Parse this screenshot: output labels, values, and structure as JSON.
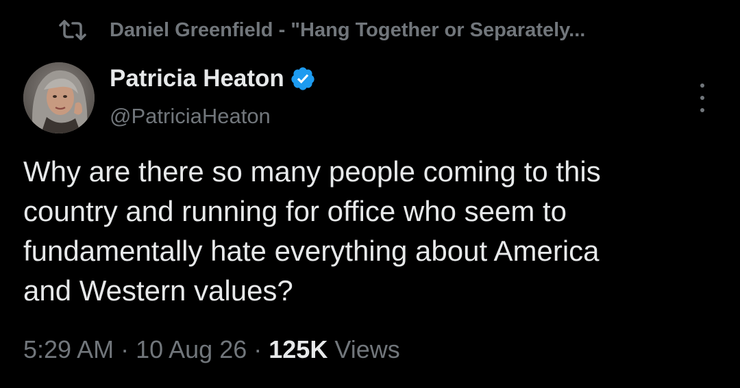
{
  "retweet": {
    "icon": "retweet-icon",
    "text": "Daniel Greenfield - \"Hang Together or Separately..."
  },
  "author": {
    "name": "Patricia Heaton",
    "handle": "@PatriciaHeaton",
    "verified_icon": "verified-badge-icon",
    "verified_color": "#1d9bf0"
  },
  "more_icon": "more-options-icon",
  "tweet": {
    "lines": [
      "Why are there so many people coming to this",
      "country and running for office who seem to",
      "fundamentally hate everything about America",
      "and Western values?"
    ]
  },
  "meta": {
    "time": "5:29 AM",
    "separator": "·",
    "date": "10 Aug 26",
    "views_count": "125K",
    "views_label": "Views"
  },
  "colors": {
    "background": "#000000",
    "primary_text": "#e7e9ea",
    "secondary_text": "#71767b",
    "accent": "#1d9bf0"
  }
}
